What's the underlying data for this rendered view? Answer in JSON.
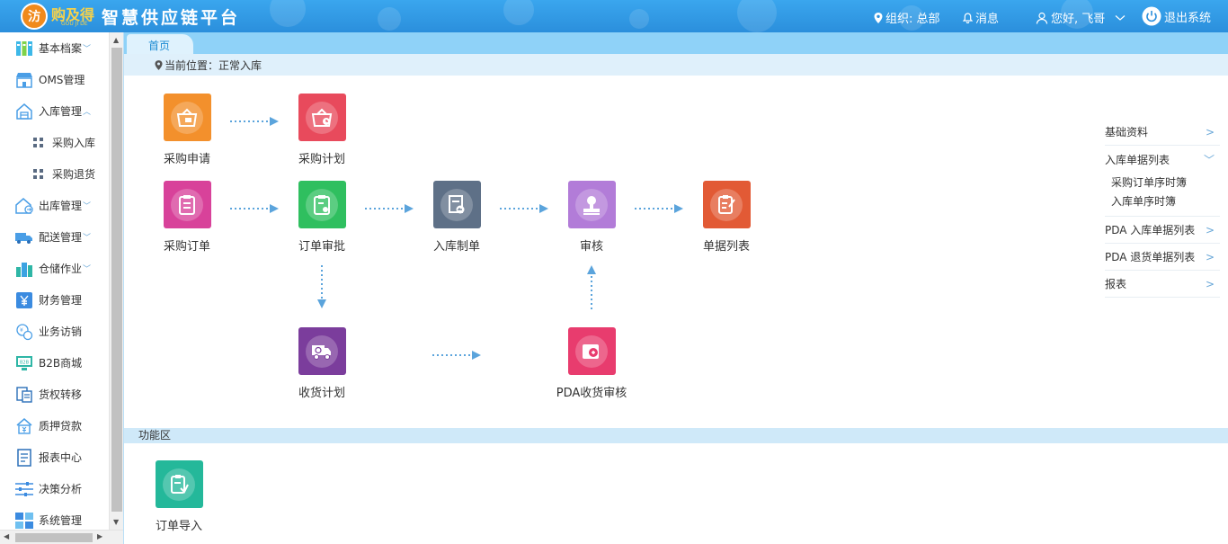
{
  "header": {
    "logo_badge": "汸",
    "logo_text": "购及得",
    "logo_sub": "GOU JI DE",
    "title": "智慧供应链平台",
    "org": "组织: 总部",
    "messages": "消息",
    "greeting": "您好, 飞哥",
    "logout": "退出系统"
  },
  "sidebar": {
    "items": [
      {
        "label": "基本档案",
        "icon": "files-icon",
        "expand": "﹀"
      },
      {
        "label": "OMS管理",
        "icon": "store-icon"
      },
      {
        "label": "入库管理",
        "icon": "warehouse-in-icon",
        "expand": "︿"
      },
      {
        "label": "采购入库",
        "icon": "grid-icon",
        "sub": true
      },
      {
        "label": "采购退货",
        "icon": "grid-icon",
        "sub": true
      },
      {
        "label": "出库管理",
        "icon": "warehouse-out-icon",
        "expand": "﹀"
      },
      {
        "label": "配送管理",
        "icon": "truck-icon",
        "expand": "﹀"
      },
      {
        "label": "仓储作业",
        "icon": "buildings-icon",
        "expand": "﹀"
      },
      {
        "label": "财务管理",
        "icon": "yen-icon"
      },
      {
        "label": "业务访销",
        "icon": "visit-icon"
      },
      {
        "label": "B2B商城",
        "icon": "b2b-icon"
      },
      {
        "label": "货权转移",
        "icon": "transfer-icon"
      },
      {
        "label": "质押贷款",
        "icon": "loan-icon"
      },
      {
        "label": "报表中心",
        "icon": "report-icon"
      },
      {
        "label": "决策分析",
        "icon": "sliders-icon"
      },
      {
        "label": "系统管理",
        "icon": "blocks-icon"
      }
    ]
  },
  "tabs": {
    "home": "首页"
  },
  "breadcrumb": "当前位置：正常入库",
  "flow": {
    "nodes": {
      "purchase_apply": "采购申请",
      "purchase_plan": "采购计划",
      "purchase_order": "采购订单",
      "order_review": "订单审批",
      "inbound_make": "入库制单",
      "audit": "审核",
      "doc_list": "单据列表",
      "receive_plan": "收货计划",
      "pda_receive_audit": "PDA收货审核"
    },
    "colors": {
      "orange": "#f3902c",
      "red": "#e84a5c",
      "pink": "#d8429a",
      "green": "#2fbf5f",
      "slate": "#5e7087",
      "purple": "#b27cd8",
      "orange_red": "#e25a35",
      "deep_purple": "#7b3d9c",
      "rose": "#e83c6e",
      "teal": "#24b89a"
    }
  },
  "right_panel": {
    "basic": "基础资料",
    "inbound_list": "入库单据列表",
    "inbound_subs": [
      "采购订单序时簿",
      "入库单序时簿"
    ],
    "pda_in": "PDA 入库单据列表",
    "pda_return": "PDA 退货单据列表",
    "report": "报表"
  },
  "function_area": {
    "title": "功能区",
    "order_import": "订单导入"
  }
}
